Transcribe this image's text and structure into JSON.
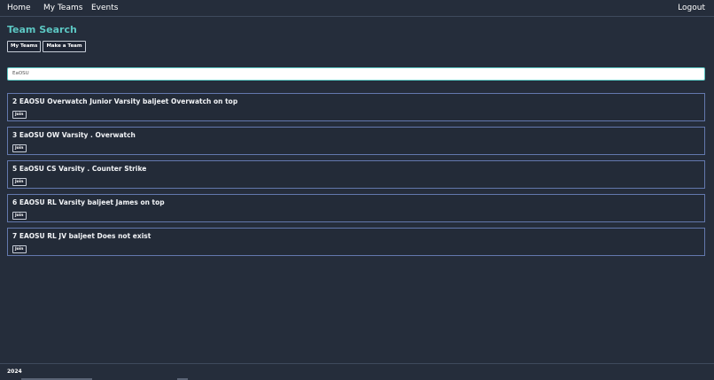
{
  "nav": {
    "home": "Home",
    "my_teams": "My Teams",
    "events": "Events",
    "logout": "Logout"
  },
  "page": {
    "title": "Team Search",
    "my_teams_button": "My Teams",
    "make_team_button": "Make a Team"
  },
  "search": {
    "value": "EaOSU",
    "placeholder": ""
  },
  "teams": [
    {
      "title": "2 EAOSU Overwatch Junior Varsity baljeet Overwatch on top",
      "join_label": "Join"
    },
    {
      "title": "3 EaOSU OW Varsity . Overwatch",
      "join_label": "Join"
    },
    {
      "title": "5 EaOSU CS Varsity . Counter Strike",
      "join_label": "Join"
    },
    {
      "title": "6 EAOSU RL Varsity baljeet James on top",
      "join_label": "Join"
    },
    {
      "title": "7 EAOSU RL JV baljeet Does not exist",
      "join_label": "Join"
    }
  ],
  "footer": {
    "year": "2024"
  },
  "colors": {
    "background": "#252d3b",
    "accent": "#5cc7c3",
    "card_border": "#6378ad"
  }
}
